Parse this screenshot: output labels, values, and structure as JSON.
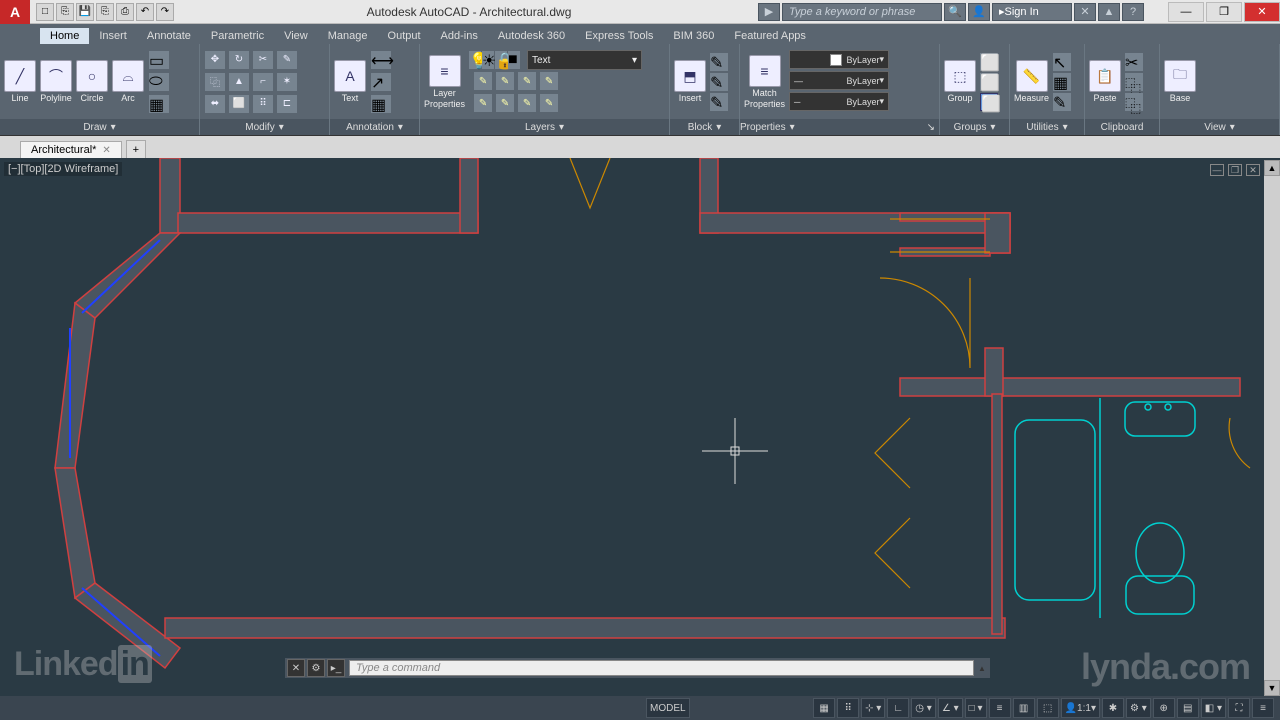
{
  "title": "Autodesk AutoCAD - Architectural.dwg",
  "help_placeholder": "Type a keyword or phrase",
  "signin": "Sign In",
  "tabs": [
    "Home",
    "Insert",
    "Annotate",
    "Parametric",
    "View",
    "Manage",
    "Output",
    "Add-ins",
    "Autodesk 360",
    "Express Tools",
    "BIM 360",
    "Featured Apps"
  ],
  "draw": {
    "line": "Line",
    "polyline": "Polyline",
    "circle": "Circle",
    "arc": "Arc",
    "label": "Draw"
  },
  "modify": {
    "label": "Modify"
  },
  "annot": {
    "text": "Text",
    "label": "Annotation"
  },
  "layers": {
    "prop1": "Layer",
    "prop2": "Properties",
    "dd": "Text",
    "label": "Layers"
  },
  "block": {
    "insert": "Insert",
    "label": "Block"
  },
  "props": {
    "match": "Match",
    "match2": "Properties",
    "bylayer": "ByLayer",
    "label": "Properties"
  },
  "groups": {
    "group": "Group",
    "label": "Groups"
  },
  "util": {
    "measure": "Measure",
    "label": "Utilities"
  },
  "clip": {
    "paste": "Paste",
    "label": "Clipboard"
  },
  "view": {
    "base": "Base",
    "label": "View"
  },
  "doctab": "Architectural*",
  "viewlabel": "[−][Top][2D Wireframe]",
  "cmd_placeholder": "Type a command",
  "status": {
    "model": "MODEL",
    "scale": "1:1"
  },
  "watermark1a": "Linked",
  "watermark1b": "in",
  "watermark2": "lynda.com"
}
